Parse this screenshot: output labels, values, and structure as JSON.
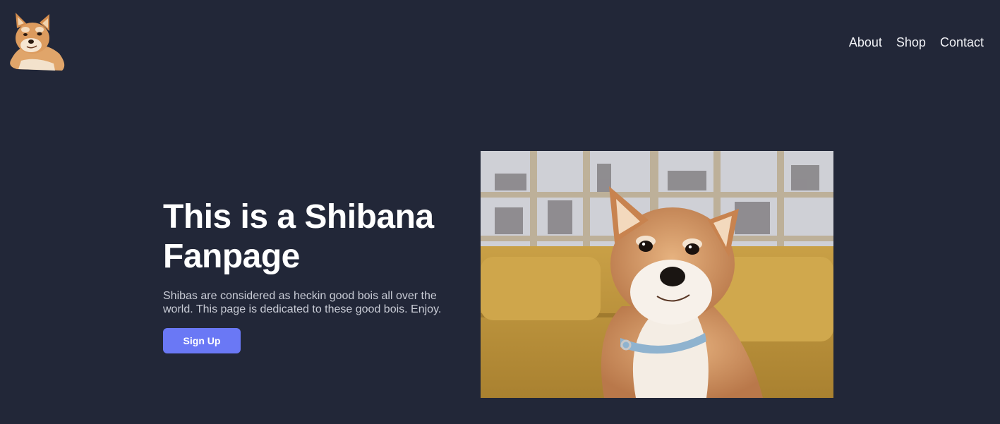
{
  "header": {
    "logo_icon": "shiba-head-logo",
    "nav": [
      {
        "label": "About"
      },
      {
        "label": "Shop"
      },
      {
        "label": "Contact"
      }
    ]
  },
  "hero": {
    "title_line1": "This is a Shibana",
    "title_line2": "Fanpage",
    "description": "Shibas are considered as heckin good bois all over the world. This page is dedicated to these good bois. Enjoy.",
    "signup_label": "Sign Up",
    "photo_icon": "shiba-dog-photo"
  },
  "colors": {
    "background": "#222738",
    "accent": "#6a78f5",
    "text": "#ffffff",
    "muted_text": "#c9ccd6"
  }
}
